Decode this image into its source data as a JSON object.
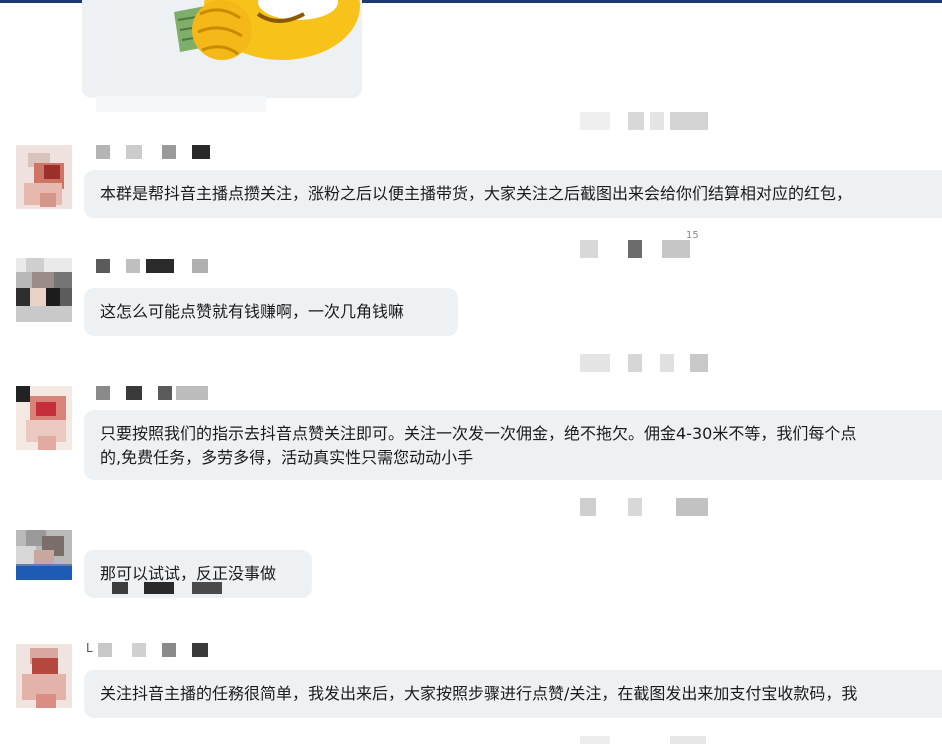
{
  "conversation": {
    "messages": [
      {
        "text_lines": [
          "本群是帮抖音主播点攒关注，涨粉之后以便主播带货，大家关注之后截图出来会给你们结算相对应的红包，"
        ]
      },
      {
        "text_lines": [
          "这怎么可能点赞就有钱赚啊，一次几角钱嘛"
        ]
      },
      {
        "text_lines": [
          "只要按照我们的指示去抖音点赞关注即可。关注一次发一次佣金，绝不拖欠。佣金4-30米不等，我们每个点",
          "的,免费任务，多劳多得，活动真实性只需您动动小手"
        ]
      },
      {
        "text_lines": [
          "那可以试试，反正没事做"
        ]
      },
      {
        "text_lines": [
          "关注抖音主播的任務很简单，我发出来后，大家按照步骤进行点赞/关注，在截图发出来加支付宝收款码，我"
        ]
      }
    ],
    "stray_marks": {
      "partial_number": "15",
      "name_fragment": "L"
    }
  },
  "colors": {
    "bubble_bg": "#eef1f4",
    "top_bar": "#1f3a70",
    "sticker_yellow": "#f7c21a"
  },
  "icons": {
    "sticker": "money-emoji-sticker"
  }
}
